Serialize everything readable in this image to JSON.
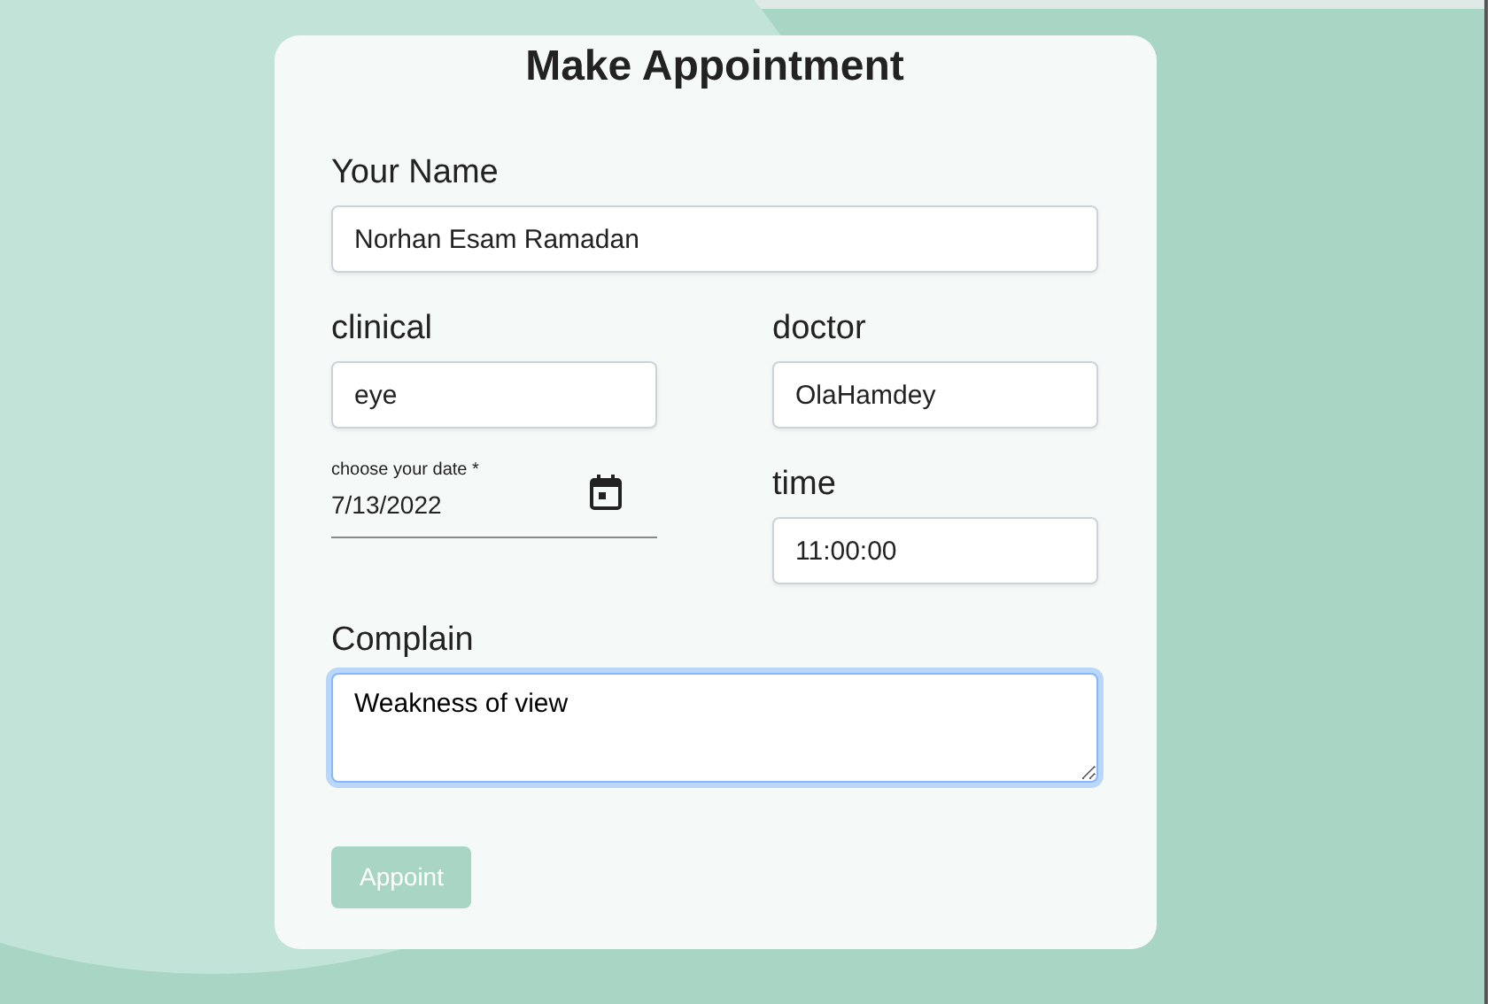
{
  "title": "Make Appointment",
  "name_field": {
    "label": "Your Name",
    "value": "Norhan Esam Ramadan"
  },
  "clinical_field": {
    "label": "clinical",
    "value": "eye"
  },
  "doctor_field": {
    "label": "doctor",
    "value": "OlaHamdey"
  },
  "date_field": {
    "label": "choose your date *",
    "value": "7/13/2022"
  },
  "time_field": {
    "label": "time",
    "value": "11:00:00"
  },
  "complain_field": {
    "label": "Complain",
    "value": "Weakness of view",
    "focused": true
  },
  "submit": {
    "label": "Appoint",
    "disabled": true
  }
}
